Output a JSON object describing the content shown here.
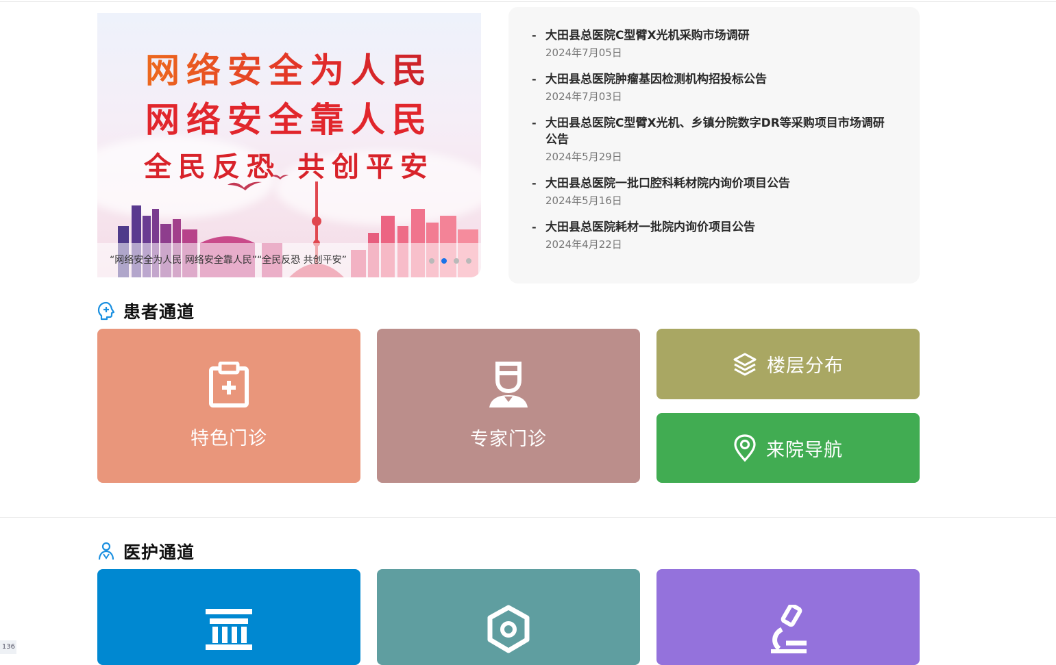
{
  "banner": {
    "slogan_line1": "网络安全为人民",
    "slogan_line2": "网络安全靠人民",
    "slogan_line3": "全民反恐 共创平安",
    "caption": "“网络安全为人民 网络安全靠人民”“全民反恐 共创平安”",
    "dots": 4,
    "active_dot": 1
  },
  "news": {
    "items": [
      {
        "title": "大田县总医院C型臂X光机采购市场调研",
        "date": "2024年7月05日"
      },
      {
        "title": "大田县总医院肿瘤基因检测机构招投标公告",
        "date": "2024年7月03日"
      },
      {
        "title": "大田县总医院C型臂X光机、乡镇分院数字DR等采购项目市场调研公告",
        "date": "2024年5月29日"
      },
      {
        "title": "大田县总医院一批口腔科耗材院内询价项目公告",
        "date": "2024年5月16日"
      },
      {
        "title": "大田县总医院耗材一批院内询价项目公告",
        "date": "2024年4月22日"
      }
    ]
  },
  "patient_section": {
    "title": "患者通道",
    "tiles": [
      {
        "label": "特色门诊",
        "icon": "clipboard-plus-icon",
        "color": "#e9967b"
      },
      {
        "label": "专家门诊",
        "icon": "doctor-icon",
        "color": "#bb8e8b"
      },
      {
        "label": "楼层分布",
        "icon": "layers-icon",
        "color": "#a9a763"
      },
      {
        "label": "来院导航",
        "icon": "location-pin-icon",
        "color": "#41ac52"
      }
    ]
  },
  "medical_section": {
    "title": "医护通道",
    "tiles": [
      {
        "icon": "institution-icon",
        "color": "#0088d1"
      },
      {
        "icon": "hexagon-nut-icon",
        "color": "#5f9ea0"
      },
      {
        "icon": "microscope-icon",
        "color": "#9472dc"
      }
    ]
  },
  "corner_tag": "136"
}
